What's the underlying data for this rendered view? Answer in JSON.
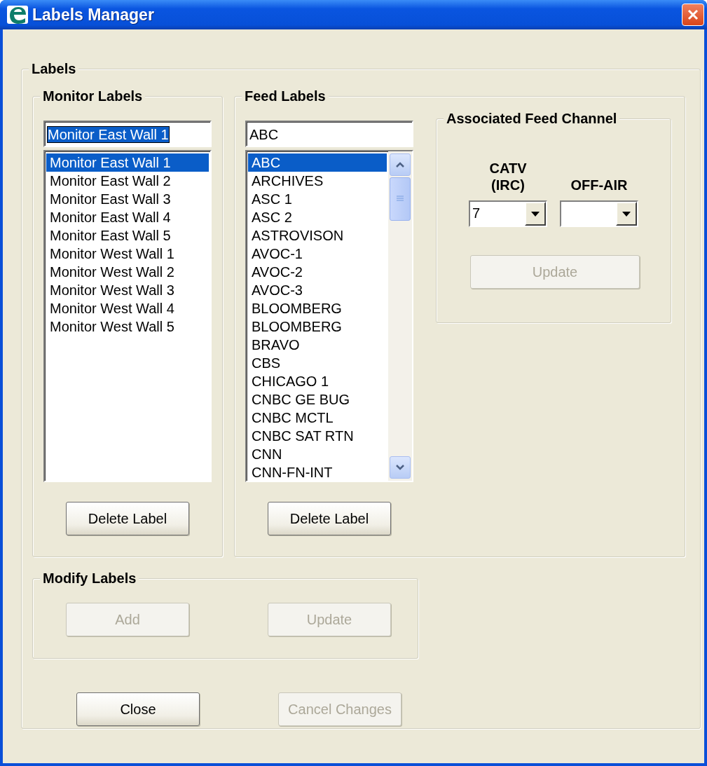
{
  "window": {
    "title": "Labels Manager"
  },
  "labels_group": {
    "title": "Labels"
  },
  "monitor_labels": {
    "title": "Monitor Labels",
    "field_value": "Monitor East Wall 1",
    "field_text_selected": true,
    "items": [
      {
        "label": "Monitor East Wall 1",
        "selected": true
      },
      {
        "label": "Monitor East Wall 2",
        "selected": false
      },
      {
        "label": "Monitor East Wall 3",
        "selected": false
      },
      {
        "label": "Monitor East Wall 4",
        "selected": false
      },
      {
        "label": "Monitor East Wall 5",
        "selected": false
      },
      {
        "label": "Monitor West Wall 1",
        "selected": false
      },
      {
        "label": "Monitor West Wall 2",
        "selected": false
      },
      {
        "label": "Monitor West Wall 3",
        "selected": false
      },
      {
        "label": "Monitor West Wall 4",
        "selected": false
      },
      {
        "label": "Monitor West Wall 5",
        "selected": false
      }
    ],
    "delete_button": {
      "label": "Delete Label",
      "disabled": false
    }
  },
  "feed_labels": {
    "title": "Feed Labels",
    "field_value": "ABC",
    "field_text_selected": false,
    "items": [
      {
        "label": "ABC",
        "selected": true
      },
      {
        "label": "ARCHIVES",
        "selected": false
      },
      {
        "label": "ASC 1",
        "selected": false
      },
      {
        "label": "ASC 2",
        "selected": false
      },
      {
        "label": "ASTROVISON",
        "selected": false
      },
      {
        "label": "AVOC-1",
        "selected": false
      },
      {
        "label": "AVOC-2",
        "selected": false
      },
      {
        "label": "AVOC-3",
        "selected": false
      },
      {
        "label": "BLOOMBERG",
        "selected": false
      },
      {
        "label": "BLOOMBERG",
        "selected": false
      },
      {
        "label": "BRAVO",
        "selected": false
      },
      {
        "label": "CBS",
        "selected": false
      },
      {
        "label": "CHICAGO 1",
        "selected": false
      },
      {
        "label": "CNBC GE BUG",
        "selected": false
      },
      {
        "label": "CNBC MCTL",
        "selected": false
      },
      {
        "label": "CNBC SAT RTN",
        "selected": false
      },
      {
        "label": "CNN",
        "selected": false
      },
      {
        "label": "CNN-FN-INT",
        "selected": false
      }
    ],
    "delete_button": {
      "label": "Delete Label",
      "disabled": false
    }
  },
  "associated_feed_channel": {
    "title": "Associated Feed Channel",
    "selectors": [
      {
        "label": "CATV (IRC)",
        "value": "7"
      },
      {
        "label": "OFF-AIR"
      }
    ],
    "update_button": {
      "label": "Update",
      "disabled": true
    }
  },
  "modify_labels": {
    "title": "Modify Labels",
    "buttons": [
      {
        "label": "Add",
        "disabled": true
      },
      {
        "label": "Update",
        "disabled": true
      }
    ]
  },
  "footer_buttons": [
    {
      "label": "Close",
      "disabled": false
    },
    {
      "label": "Cancel Changes",
      "disabled": true
    }
  ]
}
